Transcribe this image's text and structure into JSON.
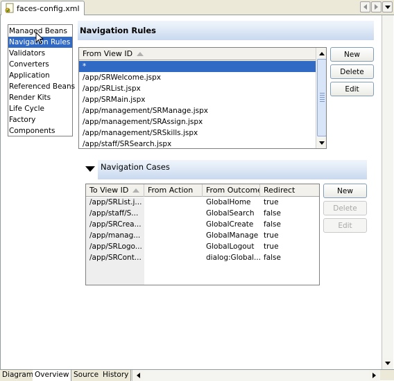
{
  "editor_tab": {
    "title": "faces-config.xml",
    "icon": "faces-config-file-icon"
  },
  "categories": [
    {
      "label": "Managed Beans",
      "selected": false
    },
    {
      "label": "Navigation Rules",
      "selected": true
    },
    {
      "label": "Validators",
      "selected": false
    },
    {
      "label": "Converters",
      "selected": false
    },
    {
      "label": "Application",
      "selected": false
    },
    {
      "label": "Referenced Beans",
      "selected": false
    },
    {
      "label": "Render Kits",
      "selected": false
    },
    {
      "label": "Life Cycle",
      "selected": false
    },
    {
      "label": "Factory",
      "selected": false
    },
    {
      "label": "Components",
      "selected": false
    }
  ],
  "rules": {
    "title": "Navigation Rules",
    "column_header": "From View ID",
    "rows": [
      "*",
      "/app/SRWelcome.jspx",
      "/app/SRList.jspx",
      "/app/SRMain.jspx",
      "/app/management/SRManage.jspx",
      "/app/management/SRAssign.jspx",
      "/app/management/SRSkills.jspx",
      "/app/staff/SRSearch.jspx"
    ],
    "selected_row": 0,
    "buttons": {
      "new": "New",
      "delete": "Delete",
      "edit": "Edit"
    }
  },
  "cases": {
    "title": "Navigation Cases",
    "columns": [
      "To View ID",
      "From Action",
      "From Outcome",
      "Redirect"
    ],
    "rows": [
      [
        "/app/SRList.j...",
        "",
        "GlobalHome",
        "true"
      ],
      [
        "/app/staff/S...",
        "",
        "GlobalSearch",
        "false"
      ],
      [
        "/app/SRCrea...",
        "",
        "GlobalCreate",
        "false"
      ],
      [
        "/app/manag...",
        "",
        "GlobalManage",
        "true"
      ],
      [
        "/app/SRLogo...",
        "",
        "GlobalLogout",
        "true"
      ],
      [
        "/app/SRCont...",
        "",
        "dialog:Global...",
        "false"
      ]
    ],
    "buttons": {
      "new": "New",
      "delete": "Delete",
      "edit": "Edit"
    }
  },
  "bottom_tabs": [
    {
      "label": "Diagram",
      "active": false
    },
    {
      "label": "Overview",
      "active": true
    },
    {
      "label": "Source",
      "active": false
    },
    {
      "label": "History",
      "active": false
    }
  ],
  "colors": {
    "selection": "#316ac5",
    "section_bar": "#dfe9f6"
  }
}
